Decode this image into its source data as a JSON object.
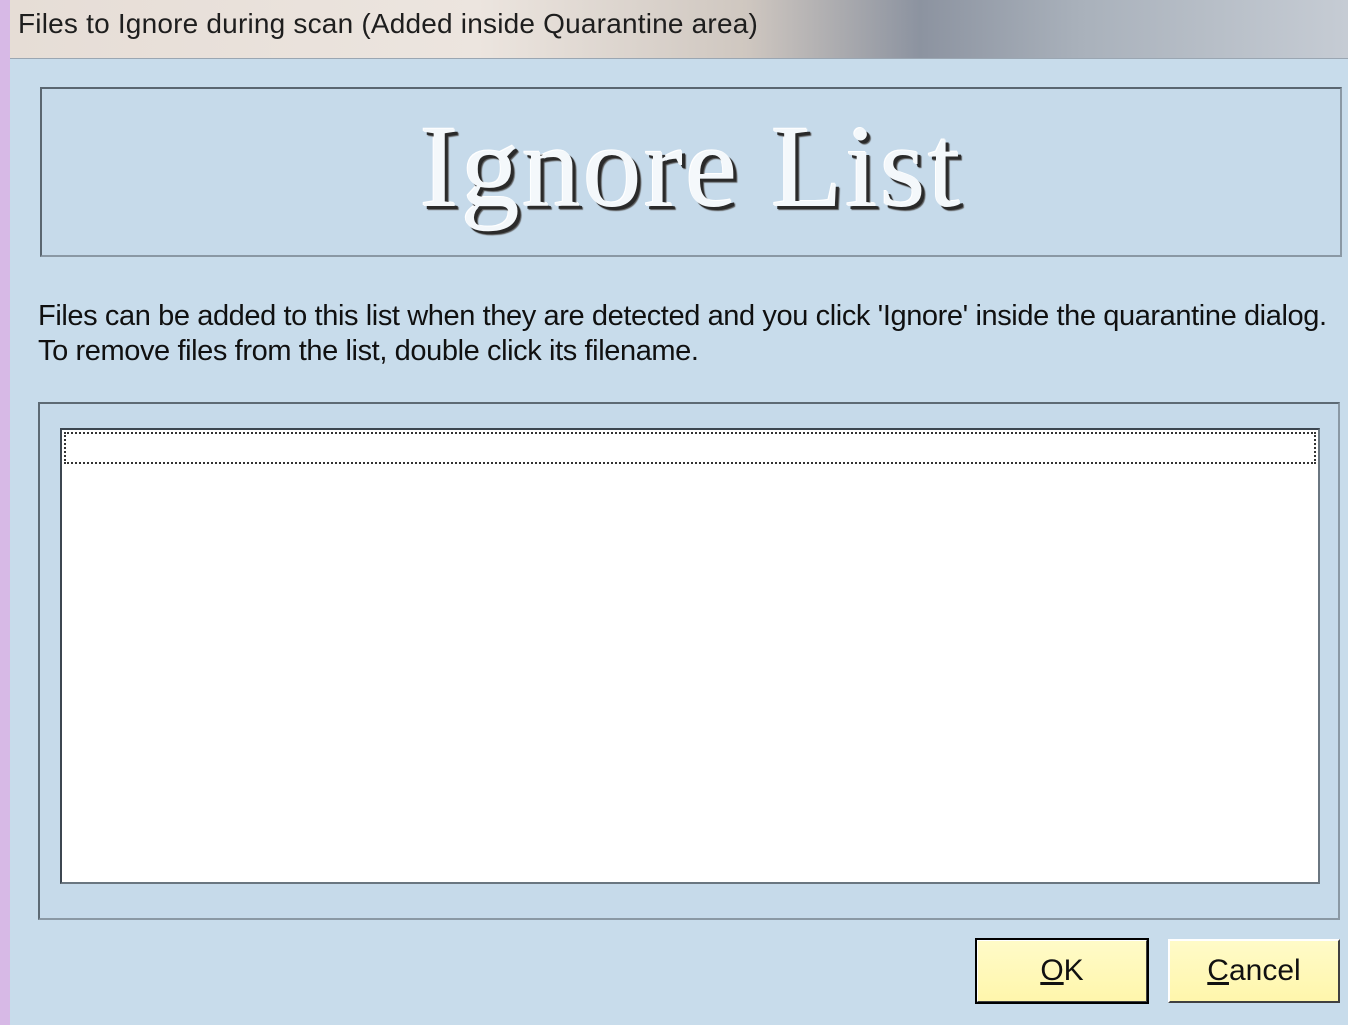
{
  "window": {
    "title": "Files to Ignore during scan (Added inside Quarantine area)"
  },
  "banner": {
    "title": "Ignore List"
  },
  "instructions": {
    "line1": "Files can be added to this list when they are detected and you click 'Ignore' inside the quarantine dialog.",
    "line2": "To remove files from the list, double click its filename."
  },
  "ignore_list": {
    "items": []
  },
  "buttons": {
    "ok_mnemonic": "O",
    "ok_rest": "K",
    "cancel_mnemonic": "C",
    "cancel_rest": "ancel"
  },
  "colors": {
    "client_bg": "#c8dceb",
    "button_bg": "#fff6ac",
    "window_frame": "#d7b9e6"
  }
}
